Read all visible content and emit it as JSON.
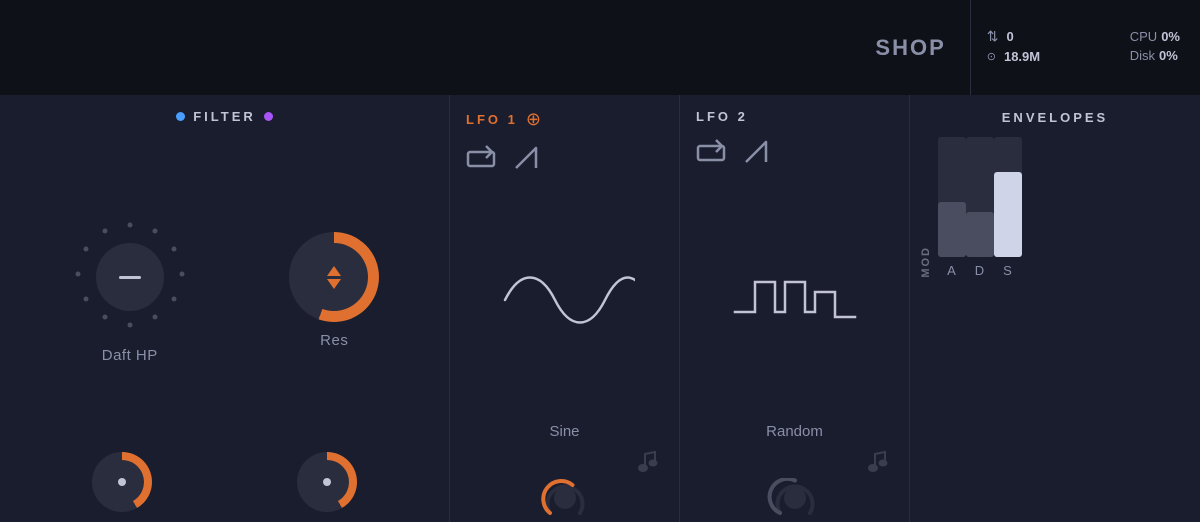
{
  "topbar": {
    "shop_label": "SHOP",
    "stats": {
      "midi_in_icon": "⇅",
      "midi_in_value": "0",
      "memory_icon": "⊙",
      "memory_value": "18.9M",
      "cpu_label": "CPU",
      "cpu_value": "0%",
      "disk_label": "Disk",
      "disk_value": "0%"
    }
  },
  "filter": {
    "title": "FILTER",
    "knob_label": "Daft HP",
    "res_label": "Res"
  },
  "lfo1": {
    "title": "LFO 1",
    "waveform_label": "Sine"
  },
  "lfo2": {
    "title": "LFO 2",
    "waveform_label": "Random"
  },
  "envelopes": {
    "title": "ENVELOPES",
    "mod_label": "MOD",
    "sliders": [
      {
        "label": "A"
      },
      {
        "label": "D"
      },
      {
        "label": "S"
      }
    ]
  }
}
